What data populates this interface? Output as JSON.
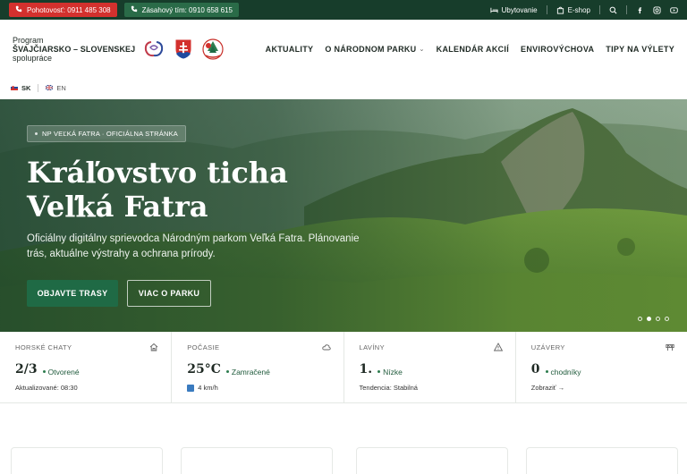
{
  "topbar": {
    "emergency_label": "Pohotovosť: 0911 485 308",
    "response_label": "Zásahový tím: 0910 658 615",
    "accommodation": "Ubytovanie",
    "eshop": "E-shop"
  },
  "header": {
    "program_line1": "Program",
    "program_line2": "ŠVAJČIARSKO – SLOVENSKEJ",
    "program_line3": "spolupráce",
    "nav": [
      {
        "label": "AKTUALITY"
      },
      {
        "label": "O NÁRODNOM PARKU"
      },
      {
        "label": "KALENDÁR AKCIÍ"
      },
      {
        "label": "ENVIROVÝCHOVA"
      },
      {
        "label": "TIPY NA VÝLETY"
      }
    ]
  },
  "languages": [
    {
      "code": "SK",
      "active": true
    },
    {
      "code": "EN",
      "active": false
    }
  ],
  "hero": {
    "badge": "NP VEĽKÁ FATRA · OFICIÁLNA STRÁNKA",
    "title_line1": "Kráľovstvo ticha",
    "title_line2": "Veľká Fatra",
    "subtitle": "Oficiálny digitálny sprievodca Národným parkom Veľká Fatra. Plánovanie trás, aktuálne výstrahy a ochrana prírody.",
    "primary_cta": "OBJAVTE TRASY",
    "secondary_cta": "VIAC O PARKU",
    "slides_total": 4,
    "slide_active": 2
  },
  "cards": [
    {
      "label": "HORSKÉ CHATY",
      "icon": "home-icon",
      "value": "2/3",
      "status": "Otvorené",
      "foot": "Aktualizované: 08:30"
    },
    {
      "label": "POČASIE",
      "icon": "cloud-icon",
      "value": "25°C",
      "status": "Zamračené",
      "foot": "4 km/h"
    },
    {
      "label": "LAVÍNY",
      "icon": "warning-icon",
      "value": "1.",
      "status": "Nízke",
      "foot": "Tendencia: Stabilná"
    },
    {
      "label": "UZÁVERY",
      "icon": "barrier-icon",
      "value": "0",
      "status": "chodníky",
      "foot": "Zobraziť →"
    }
  ],
  "colors": {
    "brand_dark": "#173d2b",
    "brand_green": "#1f6a45",
    "alert_red": "#d3312e"
  }
}
